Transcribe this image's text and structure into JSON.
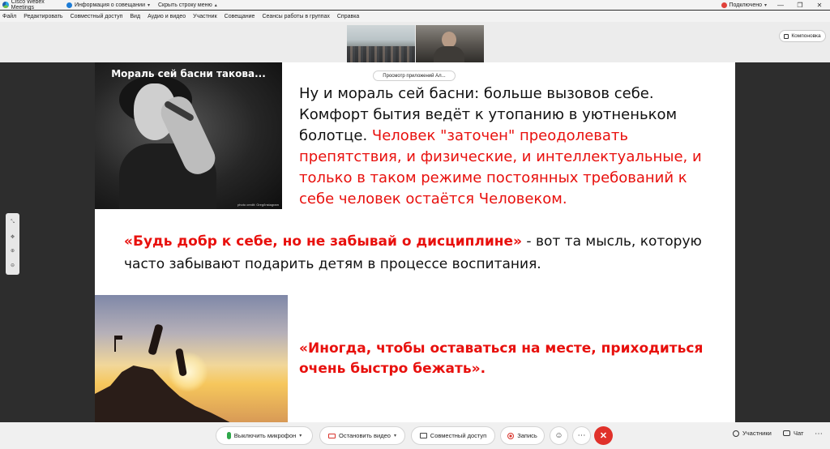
{
  "titlebar": {
    "app_name": "Cisco Webex Meetings",
    "meeting_info": "Информация о совещании",
    "hide_menu": "Скрыть строку меню",
    "connection_status": "Подключено"
  },
  "menu": [
    "Файл",
    "Редактировать",
    "Совместный доступ",
    "Вид",
    "Аудио и видео",
    "Участник",
    "Совещание",
    "Сеансы работы в группах",
    "Справка"
  ],
  "layout_button": "Компоновка",
  "viewer_pill": "Просмотр приложений Ал...",
  "slide": {
    "image1_caption": "Мораль сей басни такова...",
    "image1_credit": "photo credit: Greg/Instagram",
    "para1_black": "Ну и мораль сей басни: больше вызовов себе. Комфорт бытия ведёт к утопанию в уютненьком болотце. ",
    "para1_red": "Человек \"заточен\" преодолевать препятствия, и физические, и интеллектуальные, и только в таком режиме постоянных требований к себе человек остаётся Человеком.",
    "para2_red": "«Будь добр к себе, но не забывай о дисциплине»",
    "para2_black": " - вот та мысль, которую часто забывают подарить детям в процессе воспитания.",
    "para3_red": "«Иногда, чтобы оставаться на месте, приходиться очень быстро бежать»."
  },
  "controls": {
    "mute": "Выключить микрофон",
    "stop_video": "Остановить видео",
    "share": "Совместный доступ",
    "record": "Запись",
    "participants": "Участники",
    "chat": "Чат"
  },
  "colors": {
    "accent_red": "#e8100d",
    "mic_green": "#2ea84a",
    "leave_red": "#e0312a"
  }
}
